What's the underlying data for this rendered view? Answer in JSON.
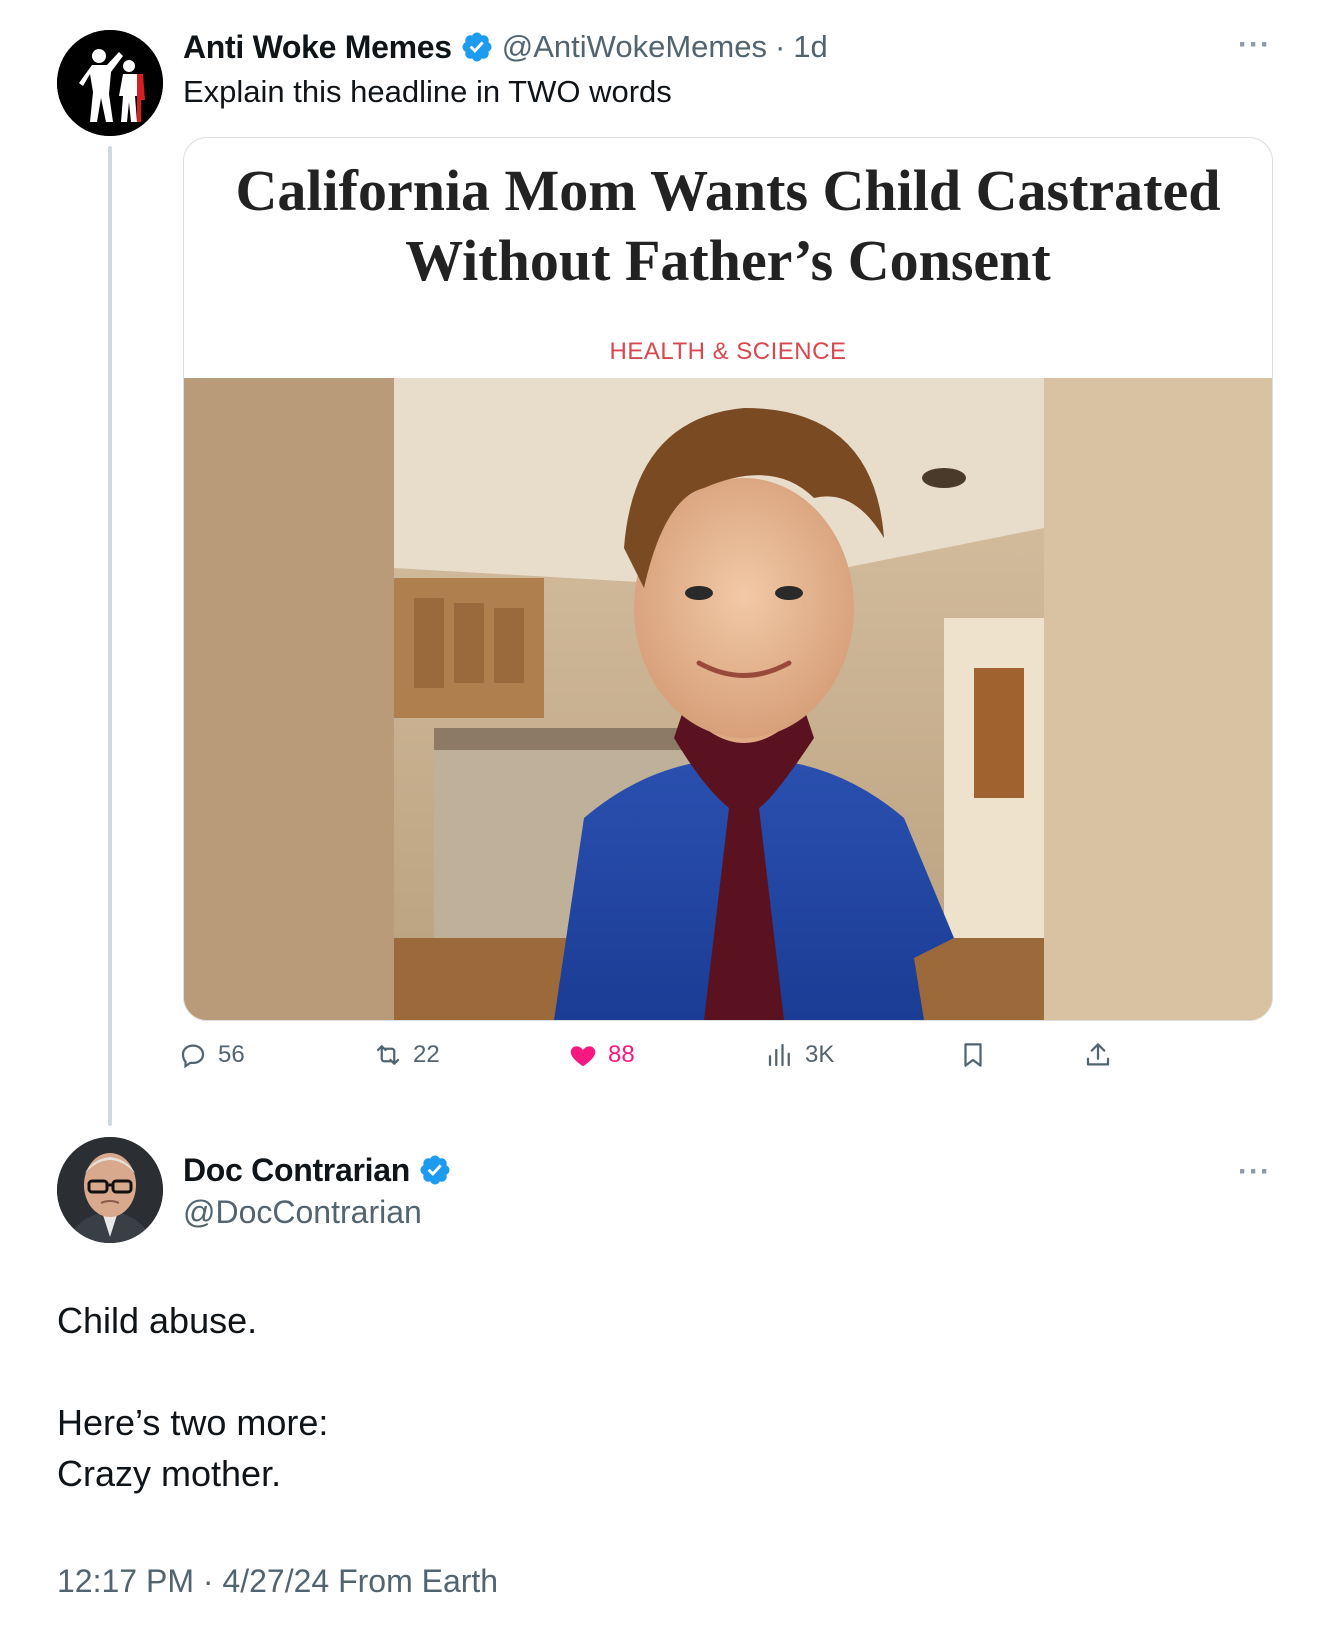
{
  "tweet": {
    "author_name": "Anti Woke Memes",
    "handle": "@AntiWokeMemes",
    "separator": "·",
    "age": "1d",
    "text": "Explain this headline in TWO words",
    "more_icon": "ellipsis-icon",
    "card": {
      "headline_line1": "California Mom Wants Child Castrated",
      "headline_line2": "Without Father’s Consent",
      "section": "HEALTH & SCIENCE"
    },
    "actions": {
      "replies": "56",
      "reposts": "22",
      "likes": "88",
      "views": "3K"
    },
    "colors": {
      "verified": "#1d9bf0",
      "like": "#f91880",
      "kicker": "#d9474f",
      "muted": "#536471"
    }
  },
  "reply": {
    "author_name": "Doc Contrarian",
    "handle": "@DocContrarian",
    "line1": "Child abuse.",
    "line2": "Here’s two more:",
    "line3": "Crazy mother.",
    "time": "12:17 PM",
    "separator": "·",
    "date": "4/27/24",
    "source": "From Earth"
  }
}
